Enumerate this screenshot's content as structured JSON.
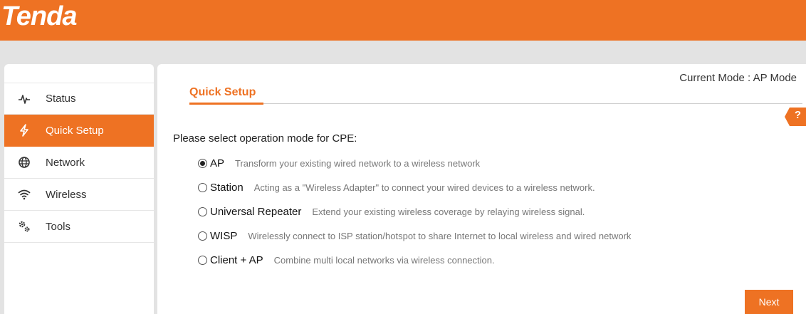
{
  "header": {
    "logo_text": "Tenda",
    "accent_color": "#ee7223"
  },
  "sidebar": {
    "items": [
      {
        "label": "Status",
        "icon": "pulse-icon",
        "active": false
      },
      {
        "label": "Quick Setup",
        "icon": "lightning-icon",
        "active": true
      },
      {
        "label": "Network",
        "icon": "globe-icon",
        "active": false
      },
      {
        "label": "Wireless",
        "icon": "wifi-icon",
        "active": false
      },
      {
        "label": "Tools",
        "icon": "gears-icon",
        "active": false
      }
    ]
  },
  "main": {
    "current_mode_label": "Current Mode : AP Mode",
    "title": "Quick Setup",
    "help_label": "?",
    "prompt": "Please select operation mode for CPE:",
    "options": [
      {
        "label": "AP",
        "description": "Transform your existing wired network to a wireless network",
        "selected": true
      },
      {
        "label": "Station",
        "description": "Acting as a \"Wireless Adapter\" to connect your wired devices to a wireless network.",
        "selected": false
      },
      {
        "label": "Universal Repeater",
        "description": "Extend your existing wireless coverage by relaying wireless signal.",
        "selected": false
      },
      {
        "label": "WISP",
        "description": "Wirelessly connect to ISP station/hotspot to share Internet to local wireless and wired network",
        "selected": false
      },
      {
        "label": "Client + AP",
        "description": "Combine multi local networks via wireless connection.",
        "selected": false
      }
    ],
    "next_label": "Next"
  }
}
